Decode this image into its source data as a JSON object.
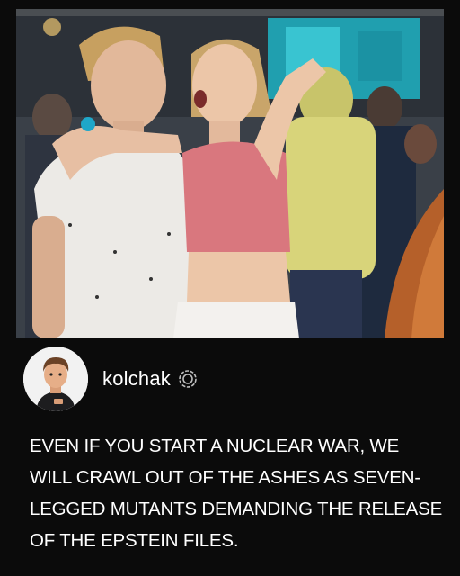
{
  "post": {
    "username": "kolchak",
    "badge_icon": "verified-ring-icon",
    "caption": "EVEN IF YOU START A NUCLEAR WAR, WE WILL CRAWL OUT OF THE ASHES AS SEVEN-LEGGED MUTANTS DEMANDING THE RELEASE OF THE EPSTEIN FILES."
  },
  "colors": {
    "background": "#0b0b0b",
    "text": "#ffffff",
    "stage_screen": "#1fb3c4"
  }
}
